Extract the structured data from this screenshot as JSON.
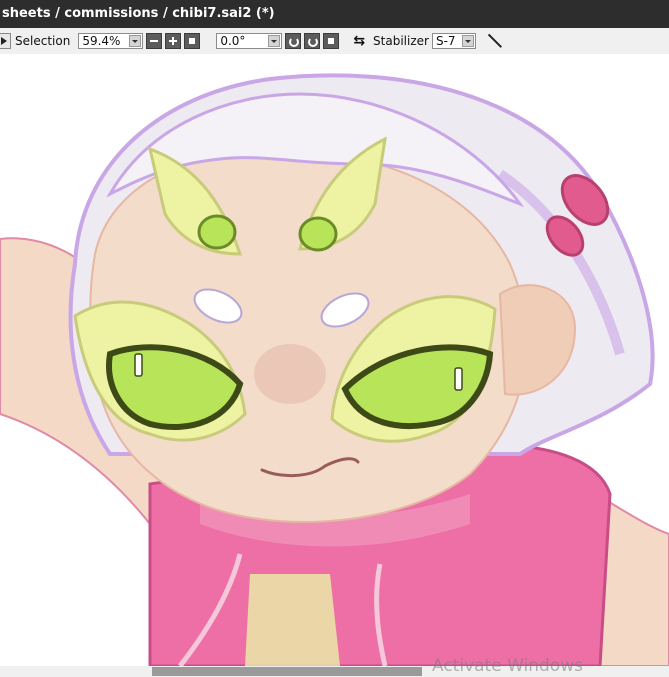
{
  "window": {
    "title": "sheets / commissions / chibi7.sai2 (*)"
  },
  "toolbar": {
    "selection_label": "Selection",
    "zoom_value": "59.4%",
    "rotation_value": "0.0°",
    "stabilizer_label": "Stabilizer",
    "stabilizer_value": "S-7"
  },
  "canvas": {
    "content": "illustration",
    "colors": {
      "hair": "#eeeaf2",
      "hair_shadow": "#c9a6e6",
      "skin": "#f3dcc9",
      "hoodie": "#ee6fa6",
      "mask": "#eef2a3",
      "eyes": "#b8e45a",
      "outline": "#4f5a2a"
    }
  },
  "watermark": {
    "text": "Activate Windows"
  }
}
